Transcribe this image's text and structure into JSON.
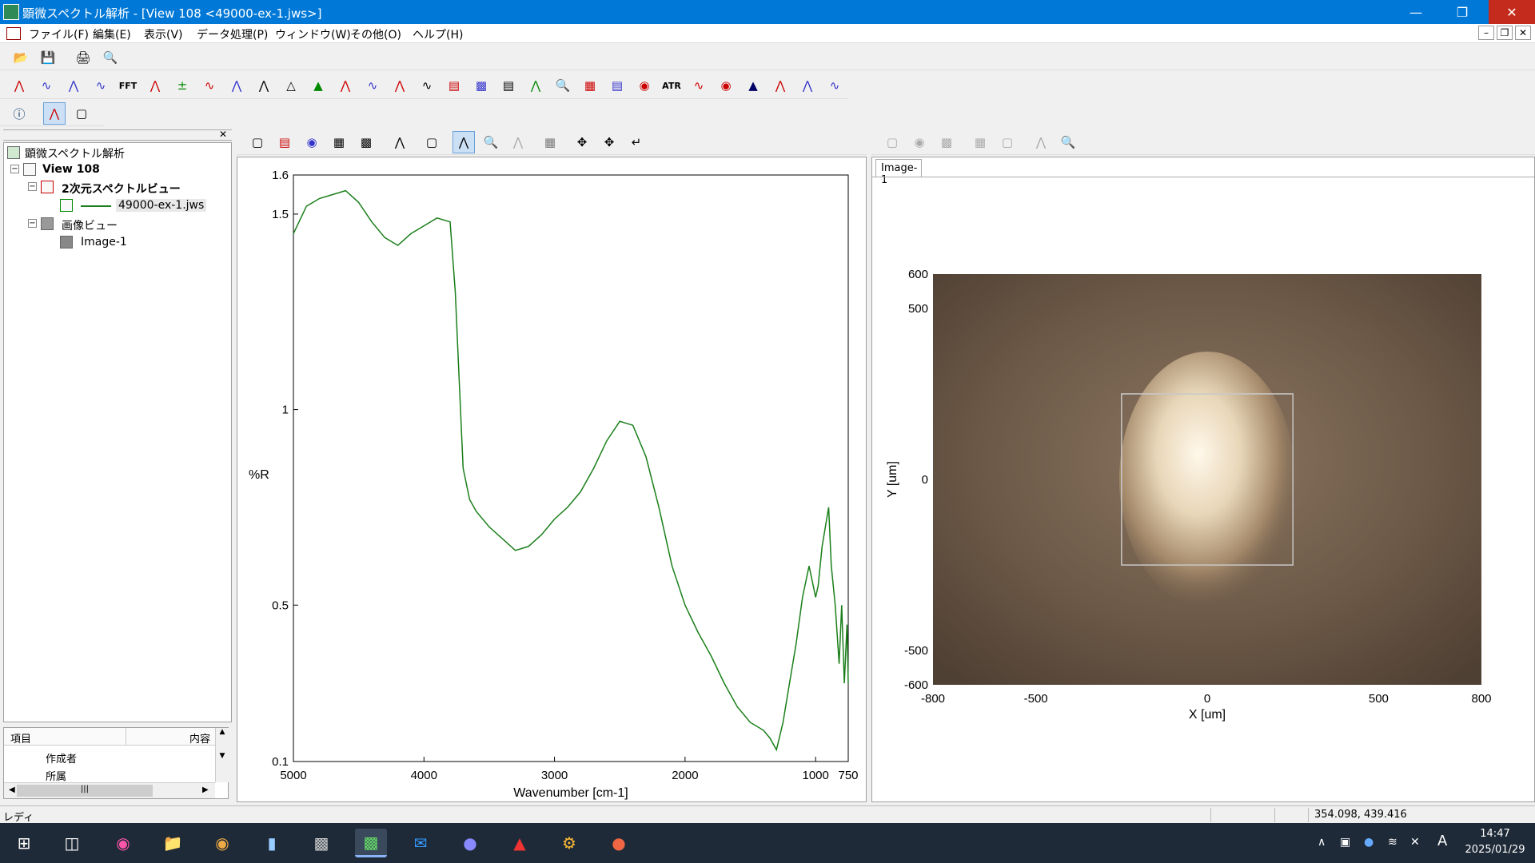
{
  "window": {
    "title": "顕微スペクトル解析 - [View 108 <49000-ex-1.jws>]"
  },
  "menu": [
    "ファイル(F)",
    "編集(E)",
    "表示(V)",
    "データ処理(P)",
    "ウィンドウ(W)",
    "その他(O)",
    "ヘルプ(H)"
  ],
  "toolbar_text": {
    "fft": "FFT",
    "atr": "ATR"
  },
  "tree": {
    "root": "顕微スペクトル解析",
    "view": "View 108",
    "spectrum_view": "2次元スペクトルビュー",
    "file": "49000-ex-1.jws",
    "image_view": "画像ビュー",
    "image": "Image-1"
  },
  "props": {
    "col_item": "項目",
    "col_content": "内容",
    "rows": [
      "作成者",
      "所属"
    ]
  },
  "image_tab": "Image-1",
  "status": {
    "text": "レディ",
    "coords": "354.098, 439.416"
  },
  "clock": {
    "time": "14:47",
    "date": "2025/01/29"
  },
  "tray_ime": "A",
  "chart_data": [
    {
      "type": "line",
      "xlabel": "Wavenumber [cm-1]",
      "ylabel": "%R",
      "xlim": [
        5000,
        750
      ],
      "ylim": [
        0.1,
        1.6
      ],
      "xticks": [
        5000,
        4000,
        3000,
        2000,
        1000,
        750
      ],
      "yticks": [
        0.1,
        0.5,
        1,
        1.5,
        1.6
      ],
      "ytick_labels": [
        "0.1",
        "0.5",
        "1",
        "1.5",
        "1.6"
      ],
      "color": "#1a7f1a",
      "x": [
        5000,
        4900,
        4800,
        4700,
        4600,
        4500,
        4400,
        4300,
        4200,
        4100,
        4000,
        3900,
        3800,
        3760,
        3720,
        3700,
        3650,
        3600,
        3500,
        3400,
        3300,
        3200,
        3100,
        3000,
        2900,
        2800,
        2700,
        2600,
        2500,
        2400,
        2300,
        2200,
        2100,
        2000,
        1900,
        1800,
        1700,
        1600,
        1500,
        1400,
        1350,
        1300,
        1250,
        1200,
        1150,
        1100,
        1050,
        1000,
        980,
        950,
        900,
        880,
        850,
        820,
        800,
        780,
        760,
        750
      ],
      "y": [
        1.45,
        1.52,
        1.54,
        1.55,
        1.56,
        1.53,
        1.48,
        1.44,
        1.42,
        1.45,
        1.47,
        1.49,
        1.48,
        1.3,
        1.0,
        0.85,
        0.77,
        0.74,
        0.7,
        0.67,
        0.64,
        0.65,
        0.68,
        0.72,
        0.75,
        0.79,
        0.85,
        0.92,
        0.97,
        0.96,
        0.88,
        0.75,
        0.6,
        0.5,
        0.43,
        0.37,
        0.3,
        0.24,
        0.2,
        0.18,
        0.16,
        0.13,
        0.2,
        0.3,
        0.4,
        0.52,
        0.6,
        0.52,
        0.55,
        0.65,
        0.75,
        0.6,
        0.5,
        0.35,
        0.5,
        0.3,
        0.45,
        0.3
      ]
    },
    {
      "type": "image-plot",
      "xlabel": "X [um]",
      "ylabel": "Y [um]",
      "xlim": [
        -800,
        800
      ],
      "ylim": [
        -600,
        600
      ],
      "xticks": [
        -800,
        -500,
        0,
        500,
        800
      ],
      "yticks": [
        600,
        500,
        0,
        -500,
        -600
      ],
      "selection_box": {
        "x": [
          -250,
          250
        ],
        "y": [
          -250,
          250
        ]
      }
    }
  ]
}
